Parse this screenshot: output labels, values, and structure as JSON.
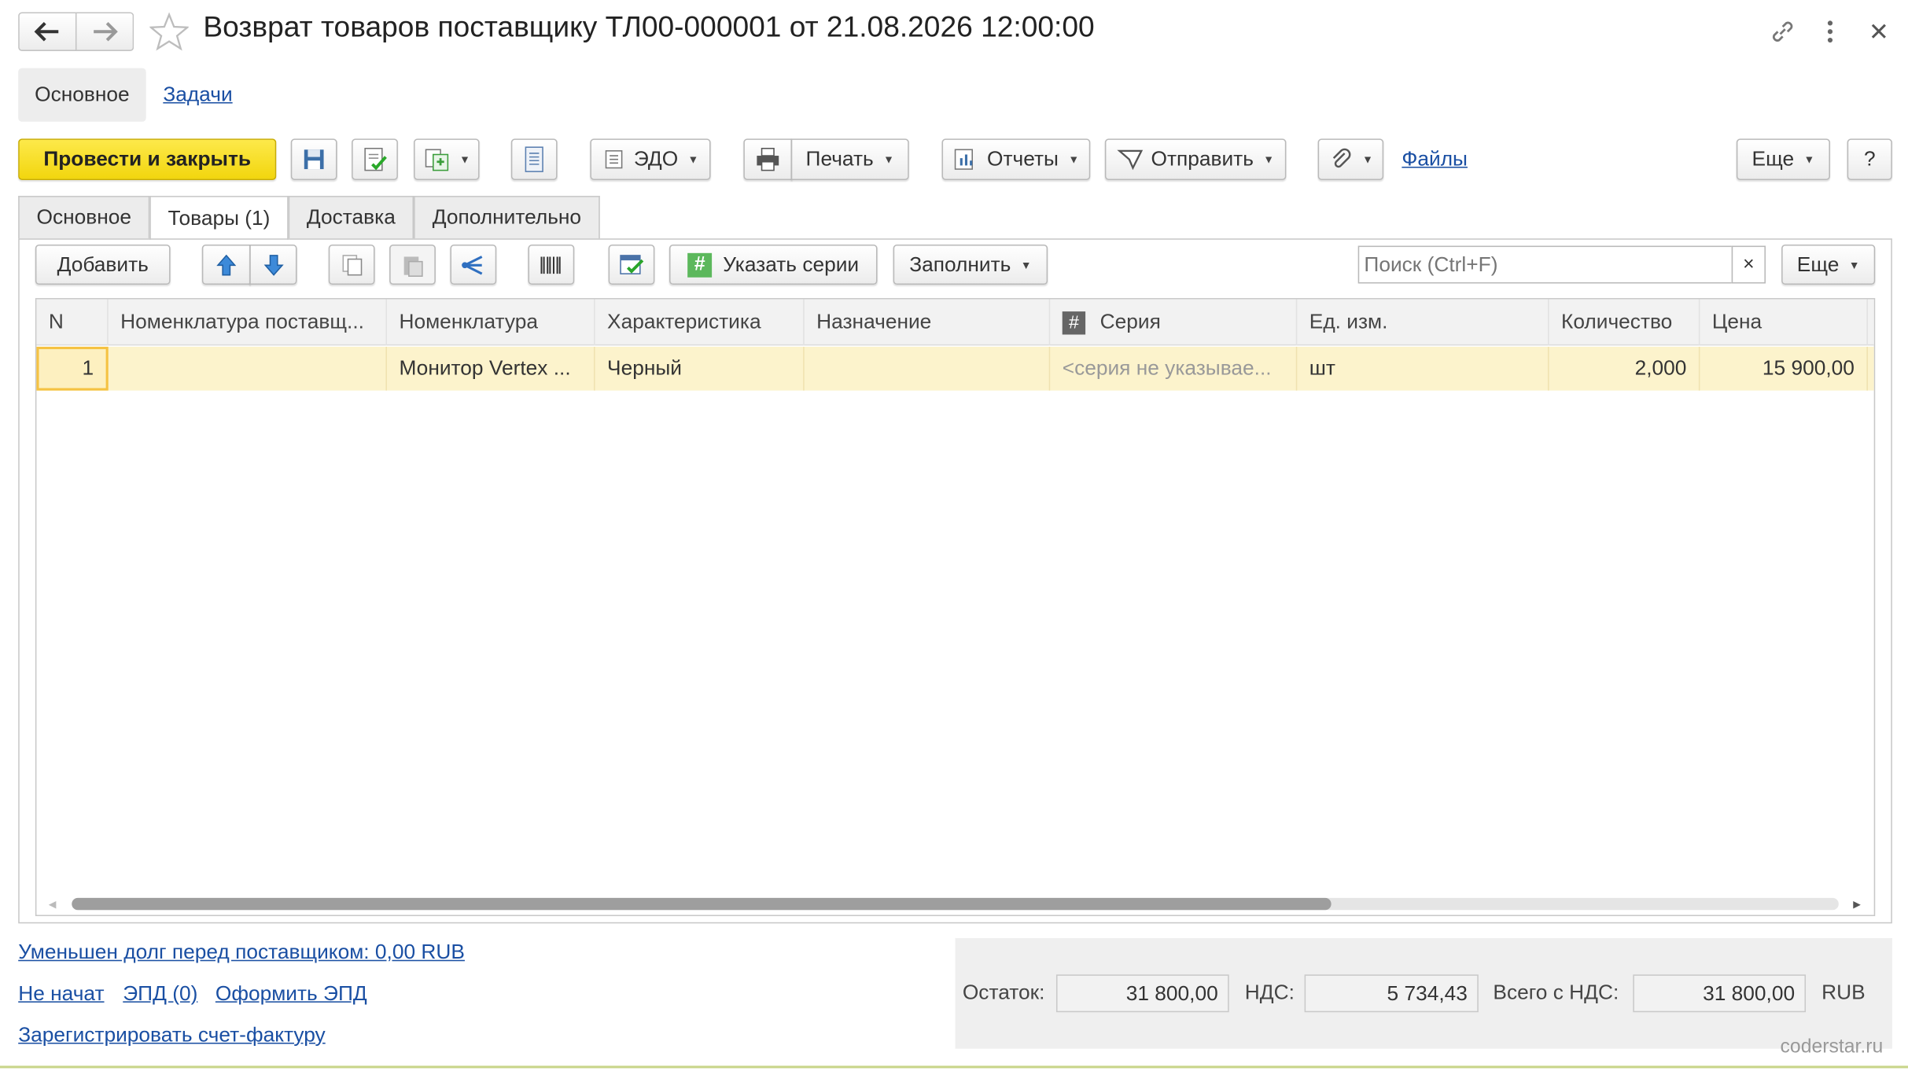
{
  "window": {
    "title": "Возврат товаров поставщику ТЛ00-000001 от 21.08.2026 12:00:00"
  },
  "nav_tabs": {
    "main": "Основное",
    "tasks": "Задачи"
  },
  "toolbar": {
    "post_close": "Провести и закрыть",
    "edo": "ЭДО",
    "print": "Печать",
    "reports": "Отчеты",
    "send": "Отправить",
    "files": "Файлы",
    "more": "Еще",
    "help": "?"
  },
  "tabs": [
    "Основное",
    "Товары (1)",
    "Доставка",
    "Дополнительно"
  ],
  "table_toolbar": {
    "add": "Добавить",
    "series": "Указать серии",
    "fill": "Заполнить",
    "search_placeholder": "Поиск (Ctrl+F)",
    "search_clear": "×",
    "more": "Еще"
  },
  "table": {
    "columns": [
      "N",
      "Номенклатура поставщ...",
      "Номенклатура",
      "Характеристика",
      "Назначение",
      "Серия",
      "Ед. изм.",
      "Количество",
      "Цена"
    ],
    "rows": [
      [
        "1",
        "",
        "Монитор Vertex ...",
        "Черный",
        "",
        "<серия не указывае...",
        "шт",
        "2,000",
        "15 900,00"
      ]
    ]
  },
  "footer": {
    "debt_link": "Уменьшен долг перед поставщиком: 0,00 RUB",
    "status_link": "Не начат",
    "epd_link": "ЭПД (0)",
    "make_epd_link": "Оформить ЭПД",
    "invoice_link": "Зарегистрировать счет-фактуру",
    "balance_label": "Остаток:",
    "balance_value": "31 800,00",
    "vat_label": "НДС:",
    "vat_value": "5 734,43",
    "total_label": "Всего с НДС:",
    "total_value": "31 800,00",
    "currency": "RUB"
  },
  "watermark": "coderstar.ru",
  "colors": {
    "accent_yellow": "#f8df2a",
    "selected_row": "#fcf3cc",
    "link": "#1a4fa3"
  }
}
